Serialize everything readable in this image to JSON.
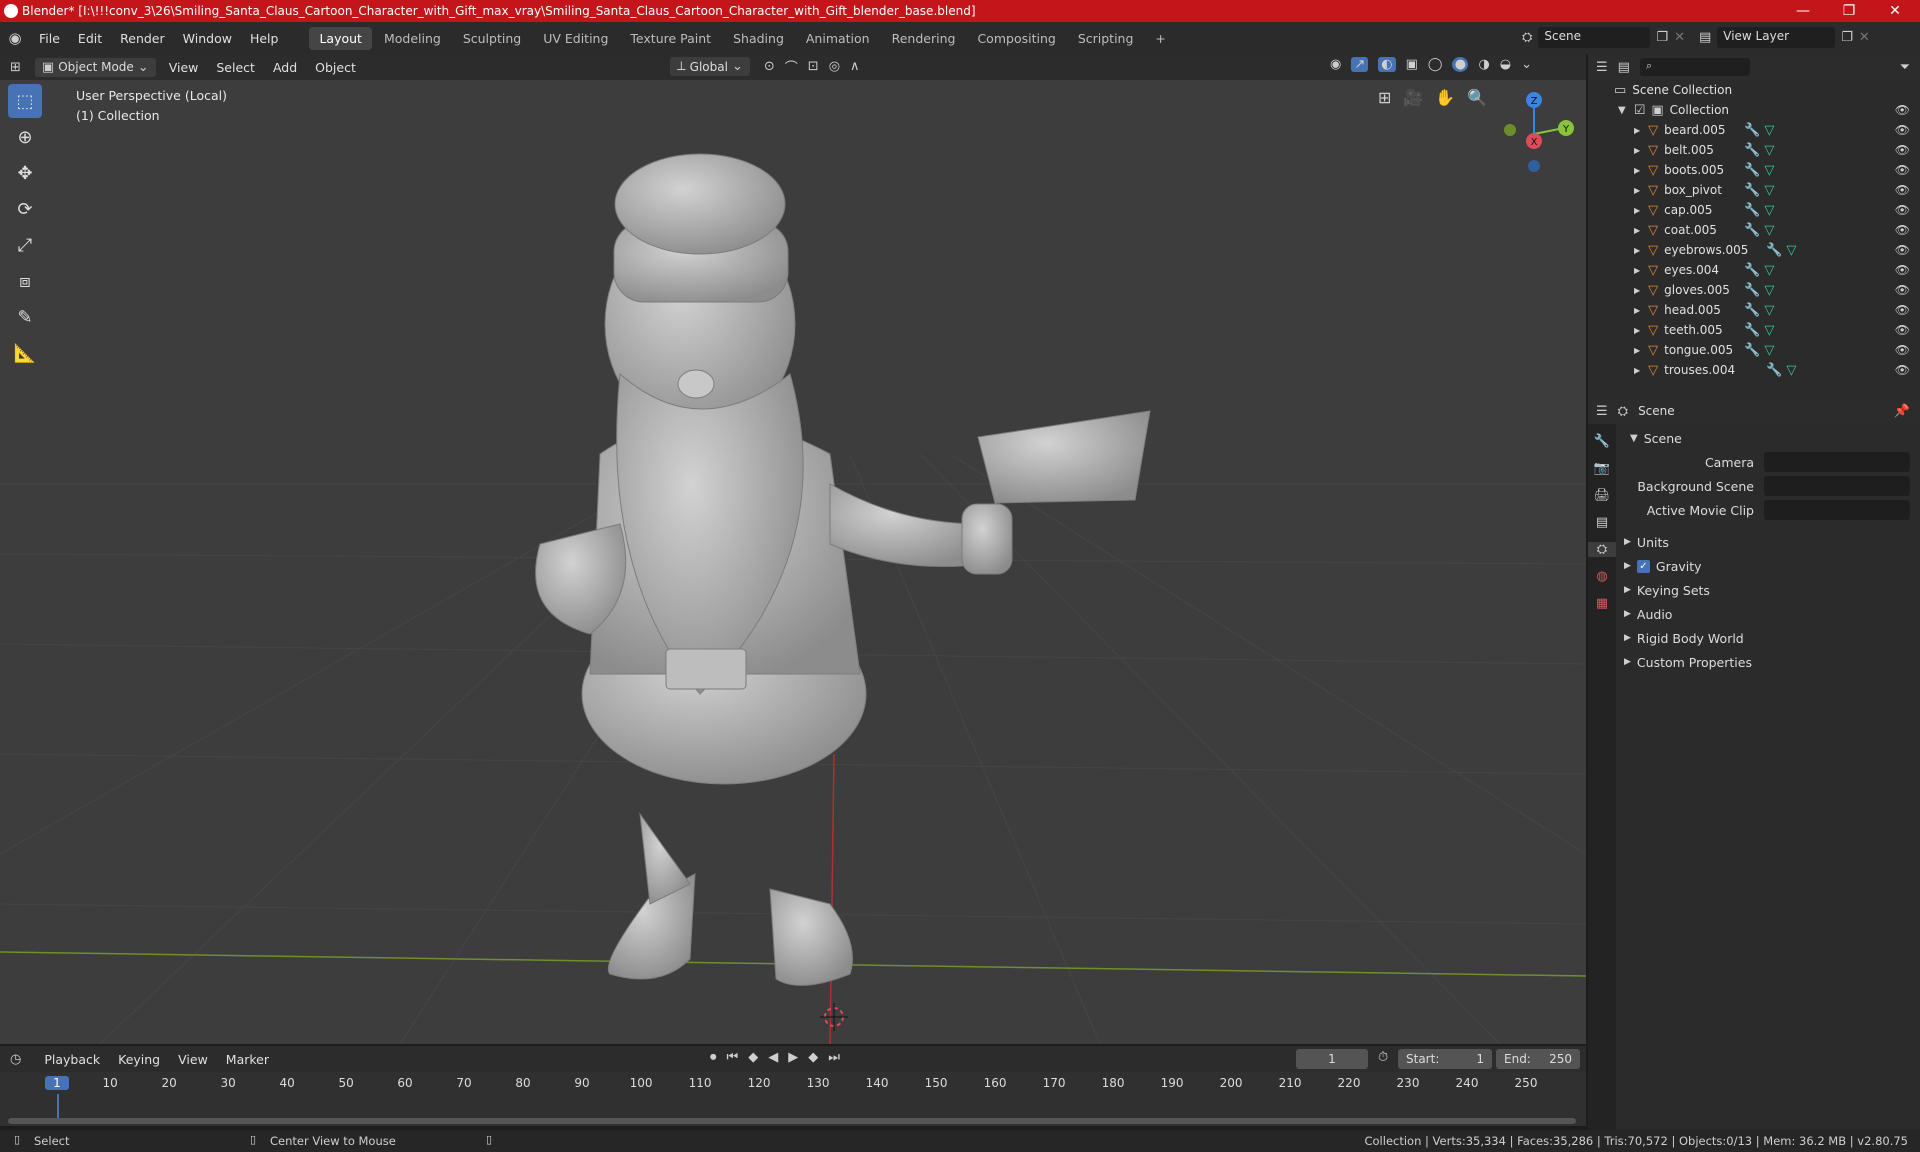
{
  "titlebar": {
    "title": "Blender* [I:\\!!!conv_3\\26\\Smiling_Santa_Claus_Cartoon_Character_with_Gift_max_vray\\Smiling_Santa_Claus_Cartoon_Character_with_Gift_blender_base.blend]",
    "minimize": "—",
    "maximize": "❐",
    "close": "✕"
  },
  "menu": [
    "File",
    "Edit",
    "Render",
    "Window",
    "Help"
  ],
  "workspaces": [
    "Layout",
    "Modeling",
    "Sculpting",
    "UV Editing",
    "Texture Paint",
    "Shading",
    "Animation",
    "Rendering",
    "Compositing",
    "Scripting"
  ],
  "active_workspace": "Layout",
  "add_workspace": "+",
  "scene_field": "Scene",
  "view_layer_field": "View Layer",
  "viewport_header": {
    "mode": "Object Mode",
    "view": "View",
    "select": "Select",
    "add": "Add",
    "object": "Object",
    "orientation": "Global"
  },
  "viewport": {
    "perspective": "User Perspective (Local)",
    "collection": "(1) Collection",
    "gizmo": {
      "z": "Z",
      "y": "Y",
      "x": "X"
    }
  },
  "outliner": {
    "root": "Scene Collection",
    "collection": "Collection",
    "objects": [
      "beard.005",
      "belt.005",
      "boots.005",
      "box_pivot",
      "cap.005",
      "coat.005",
      "eyebrows.005",
      "eyes.004",
      "gloves.005",
      "head.005",
      "teeth.005",
      "tongue.005",
      "trouses.004"
    ]
  },
  "properties": {
    "header": "Scene",
    "panel": "Scene",
    "camera_label": "Camera",
    "background_scene_label": "Background Scene",
    "active_movie_clip_label": "Active Movie Clip",
    "sections": [
      "Units",
      "Gravity",
      "Keying Sets",
      "Audio",
      "Rigid Body World",
      "Custom Properties"
    ],
    "gravity_checked": true
  },
  "timeline": {
    "playback": "Playback",
    "keying": "Keying",
    "view": "View",
    "marker": "Marker",
    "current_frame": "1",
    "start_label": "Start:",
    "start": "1",
    "end_label": "End:",
    "end": "250",
    "ruler": [
      "1",
      "10",
      "20",
      "30",
      "40",
      "50",
      "60",
      "70",
      "80",
      "90",
      "100",
      "110",
      "120",
      "130",
      "140",
      "150",
      "160",
      "170",
      "180",
      "190",
      "200",
      "210",
      "220",
      "230",
      "240",
      "250"
    ]
  },
  "statusbar": {
    "select": "Select",
    "center": "Center View to Mouse",
    "stats": "Collection | Verts:35,334 | Faces:35,286 | Tris:70,572 | Objects:0/13 | Mem: 36.2 MB | v2.80.75"
  },
  "colors": {
    "titlebar": "#c4161a",
    "active_tool": "#4772b3",
    "axis_x": "#e04a5a",
    "axis_y": "#8ac43a",
    "axis_z": "#3b84e0"
  }
}
